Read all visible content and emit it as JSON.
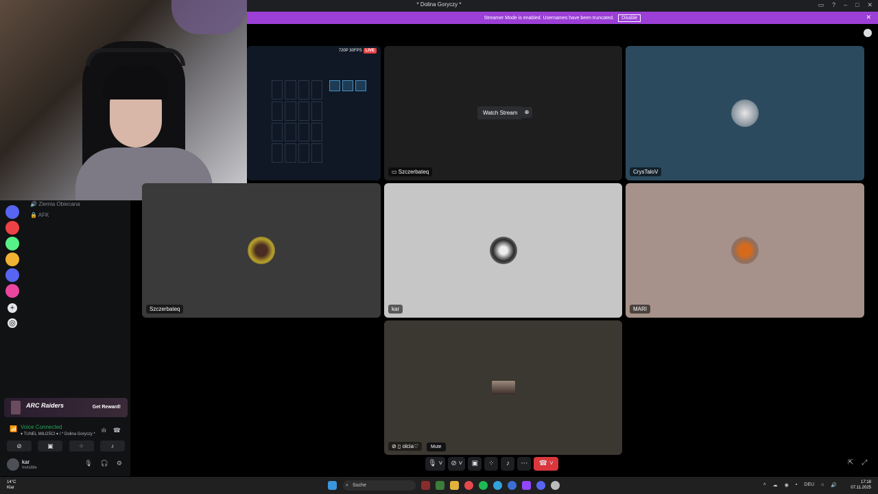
{
  "window": {
    "title": "* Dolina Goryczy *"
  },
  "banner": {
    "message": "Streamer Mode is enabled. Usernames have been truncated.",
    "disable_label": "Disable",
    "close_glyph": "✕"
  },
  "channels": [
    {
      "name": "Ziemia Obiecana"
    },
    {
      "name": "AFK"
    }
  ],
  "promo": {
    "logo_text": "ARC Raiders",
    "reward_label": "Get Reward!"
  },
  "voice": {
    "status": "Voice Connected",
    "location": "▾ TUNEL MIŁOŚCI ▾ / * Dolina Goryczy *"
  },
  "user": {
    "name": "kar",
    "status": "Invisible"
  },
  "game_stream": {
    "quality": "720P 30FPS",
    "live_label": "LIVE"
  },
  "tiles": {
    "watch_stream_label": "Watch Stream",
    "streamer_name": "Szczerbateq",
    "crys_name": "CrysTaloV",
    "szc_name": "Szczerbateq",
    "kar_name": "kar",
    "mari_name": "MARI",
    "olcia_name": "olcia♡",
    "mute_tooltip": "Mute"
  },
  "taskbar": {
    "temperature": "14°C",
    "weather": "Klar",
    "search_placeholder": "Suche",
    "language": "DEU",
    "time": "17:18",
    "date": "07.11.2025"
  },
  "colors": {
    "banner": "#9b3fd6",
    "connected": "#23a55a",
    "hangup": "#da373c"
  }
}
